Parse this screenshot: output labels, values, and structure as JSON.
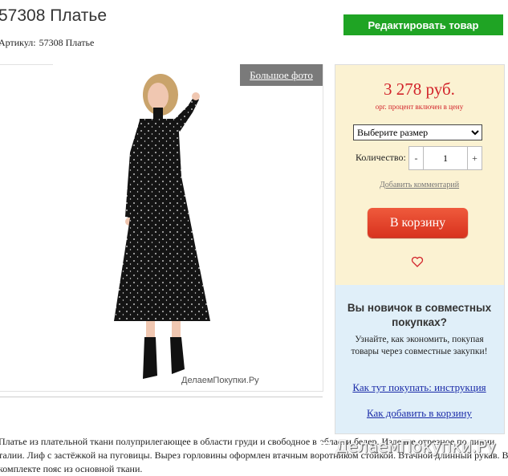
{
  "product": {
    "title": "57308 Платье",
    "sku_label": "Артикул:",
    "sku_value": "57308 Платье"
  },
  "toolbar": {
    "edit_label": "Редактировать товар"
  },
  "photo": {
    "big_photo_label": "Большое фото",
    "watermark": "ДелаемПокупки.Ру"
  },
  "buy": {
    "price": "3 278 руб.",
    "price_note": "орг. процент включен в цену",
    "size_placeholder": "Выберите размер",
    "qty_label": "Количество:",
    "qty_minus": "-",
    "qty_value": "1",
    "qty_plus": "+",
    "add_comment": "Добавить комментарий",
    "cart_label": "В корзину"
  },
  "info": {
    "title": "Вы новичок в совместных покупках?",
    "text": "Узнайте, как экономить, покупая товары через совместные закупки!",
    "link_how_to_buy": "Как тут покупать: инструкция",
    "link_add_to_cart": "Как добавить в корзину"
  },
  "description": "Платье из плательной ткани полуприлегающее в области груди и свободное в области бедер. Изделие отрезное по линии талии. Лиф с застёжкой на пуговицы. Вырез горловины оформлен втачным воротником стойкой. Втачной длинный рукав. В комплекте пояс из основной ткани.",
  "footer_watermark": "ДелаемПокупки.Ру",
  "colors": {
    "edit": "#1fa424",
    "price": "#d2232a",
    "cart": "#e2442a",
    "buy_panel": "#fbf2d2",
    "info_panel": "#e0eff9",
    "link": "#1a2ba8"
  }
}
